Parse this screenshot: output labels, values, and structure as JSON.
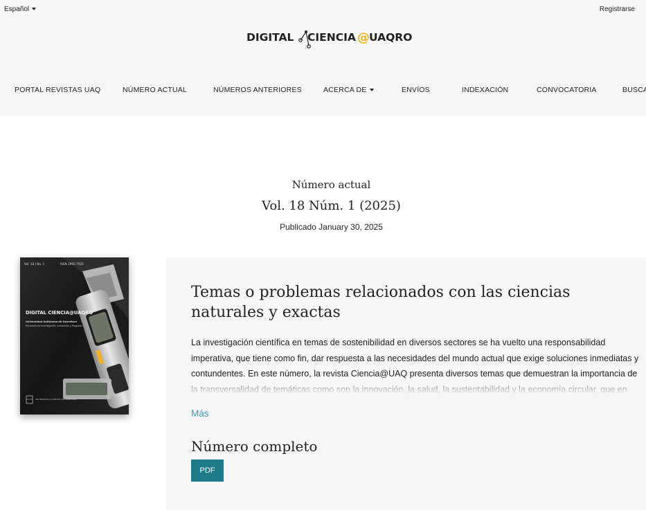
{
  "topbar": {
    "language": "Español",
    "register": "Registrarse"
  },
  "logo": {
    "part1": "DIGITAL",
    "part2": "CIENCIA",
    "at": "@",
    "part3": "UAQRO",
    "accent_color": "#f2b01e"
  },
  "nav": {
    "items": [
      {
        "label": "PORTAL REVISTAS UAQ"
      },
      {
        "label": "NÚMERO ACTUAL"
      },
      {
        "label": "NÚMEROS ANTERIORES"
      },
      {
        "label": "ACERCA DE"
      },
      {
        "label": "ENVÍOS"
      },
      {
        "label": "INDEXACIÓN"
      },
      {
        "label": "CONVOCATORIA"
      },
      {
        "label": "BUSCAR"
      }
    ]
  },
  "issue": {
    "label": "Número actual",
    "title": "Vol. 18 Núm. 1 (2025)",
    "published": "Publicado January 30, 2025"
  },
  "cover": {
    "vol": "Vol. 18 | No. 1",
    "issn": "ISSN 1991-7025",
    "logo_text": "DIGITAL CIENCIA@UAQRO",
    "subtitle": "Universidad Autónoma de Querétaro",
    "subtitle2": "Secretaría de Investigación, Innovación y Posgrado",
    "university": "UNIVERSIDAD AUTÓNOMA DE QUERÉTARO"
  },
  "article": {
    "title": "Temas o problemas relacionados con las ciencias naturales y exactas",
    "description": "La investigación científica en temas de sostenibilidad en diversos sectores se ha vuelto una responsabilidad imperativa, que tiene como fin, dar respuesta a las necesidades del mundo actual que exige soluciones inmediatas y contundentes. En este número, la revista Ciencia@UAQ presenta diversos temas que demuestran la importancia de la transversalidad de temáticas como son la innovación, la salud, la sustentabilidad y la economía circular, que en",
    "more": "Más",
    "full_issue_heading": "Número completo",
    "pdf_label": "PDF"
  },
  "colors": {
    "header_bg": "#f6f6f6",
    "link": "#3a9fba",
    "pdf_button": "#1f7b8a"
  }
}
